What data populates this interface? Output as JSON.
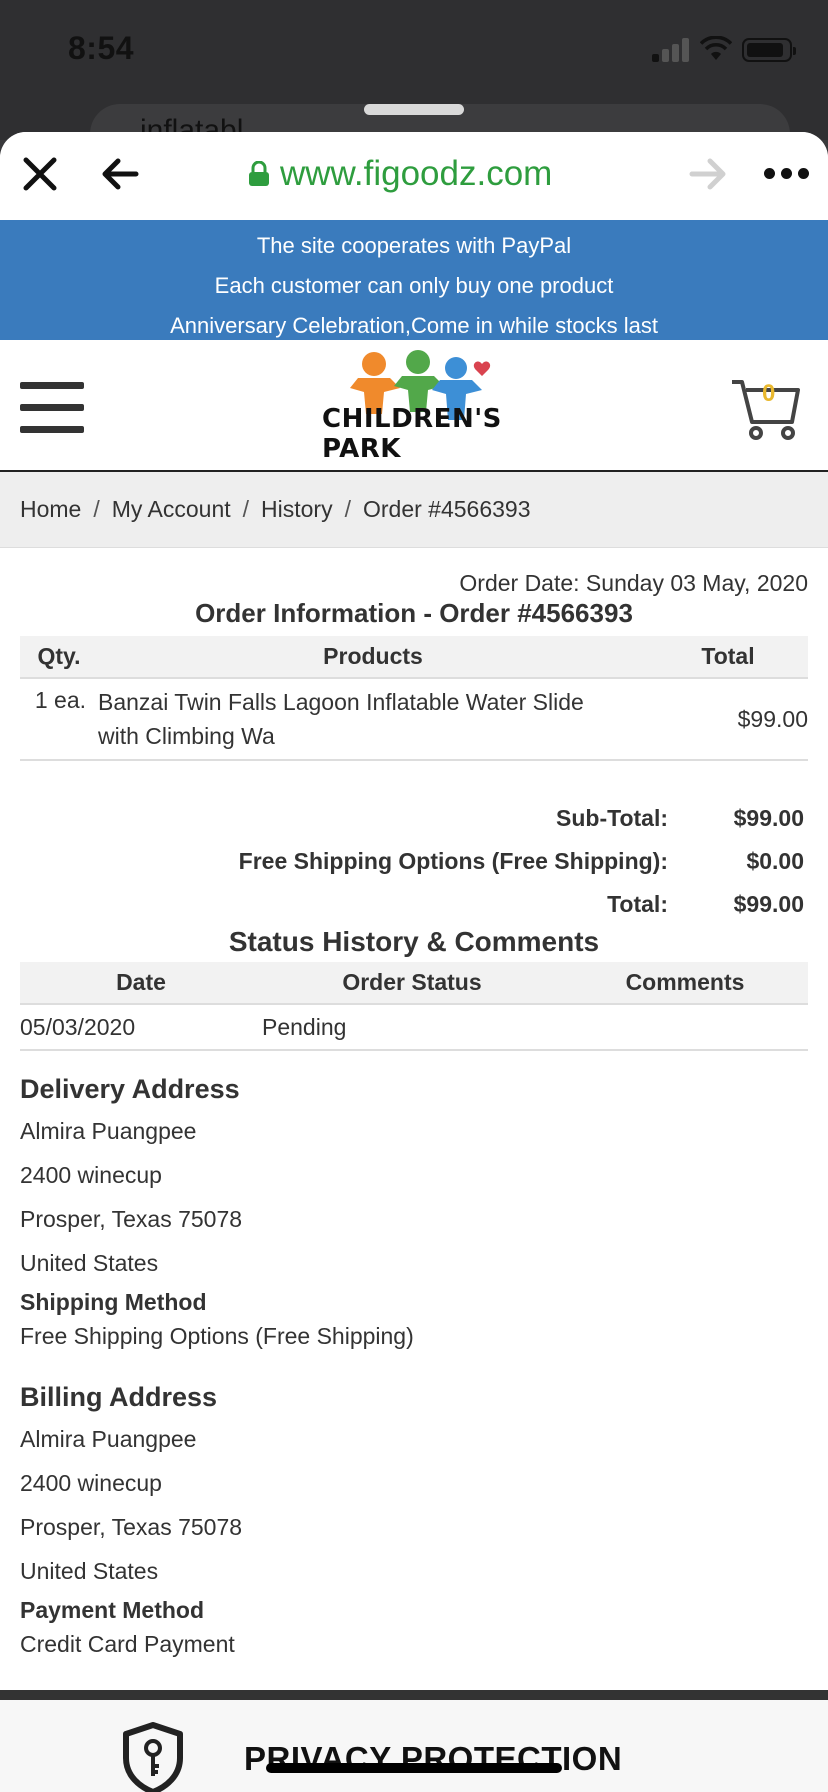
{
  "status_bar": {
    "time": "8:54"
  },
  "behind": {
    "url_hint": "inflatabl"
  },
  "browser": {
    "url": "www.figoodz.com"
  },
  "promo": {
    "lines": [
      "The site cooperates with PayPal",
      "Each customer can only buy one product",
      "Anniversary Celebration,Come in while stocks last"
    ]
  },
  "header": {
    "logo_text": "CHILDREN'S PARK",
    "cart_count": "0"
  },
  "breadcrumb": {
    "items": [
      "Home",
      "My Account",
      "History",
      "Order #4566393"
    ],
    "separator": "/"
  },
  "order": {
    "date_label": "Order Date: Sunday 03 May, 2020",
    "title": "Order Information - Order #4566393",
    "columns": {
      "qty": "Qty.",
      "products": "Products",
      "total": "Total"
    },
    "items": [
      {
        "qty": "1 ea.",
        "name": "Banzai Twin Falls Lagoon Inflatable Water Slide with Climbing Wa",
        "total": "$99.00"
      }
    ],
    "totals": [
      {
        "label": "Sub-Total:",
        "value": "$99.00"
      },
      {
        "label": "Free Shipping Options (Free Shipping):",
        "value": "$0.00"
      },
      {
        "label": "Total:",
        "value": "$99.00"
      }
    ]
  },
  "status": {
    "title": "Status History & Comments",
    "columns": {
      "date": "Date",
      "status": "Order Status",
      "comments": "Comments"
    },
    "rows": [
      {
        "date": "05/03/2020",
        "status": "Pending",
        "comments": ""
      }
    ]
  },
  "delivery": {
    "heading": "Delivery Address",
    "lines": [
      "Almira Puangpee",
      "2400 winecup",
      "Prosper, Texas 75078",
      "United States"
    ],
    "method_label": "Shipping Method",
    "method_value": "Free Shipping Options (Free Shipping)"
  },
  "billing": {
    "heading": "Billing Address",
    "lines": [
      "Almira Puangpee",
      "2400 winecup",
      "Prosper, Texas 75078",
      "United States"
    ],
    "method_label": "Payment Method",
    "method_value": "Credit Card Payment"
  },
  "footer": {
    "title": "PRIVACY PROTECTION"
  },
  "colors": {
    "promo_bg": "#3a7bbd",
    "url_green": "#2e9d3e",
    "cart_count": "#e9b82e"
  },
  "icons": [
    "close-icon",
    "back-arrow-icon",
    "lock-icon",
    "forward-arrow-icon",
    "more-icon",
    "hamburger-icon",
    "cart-icon",
    "shield-key-icon"
  ]
}
